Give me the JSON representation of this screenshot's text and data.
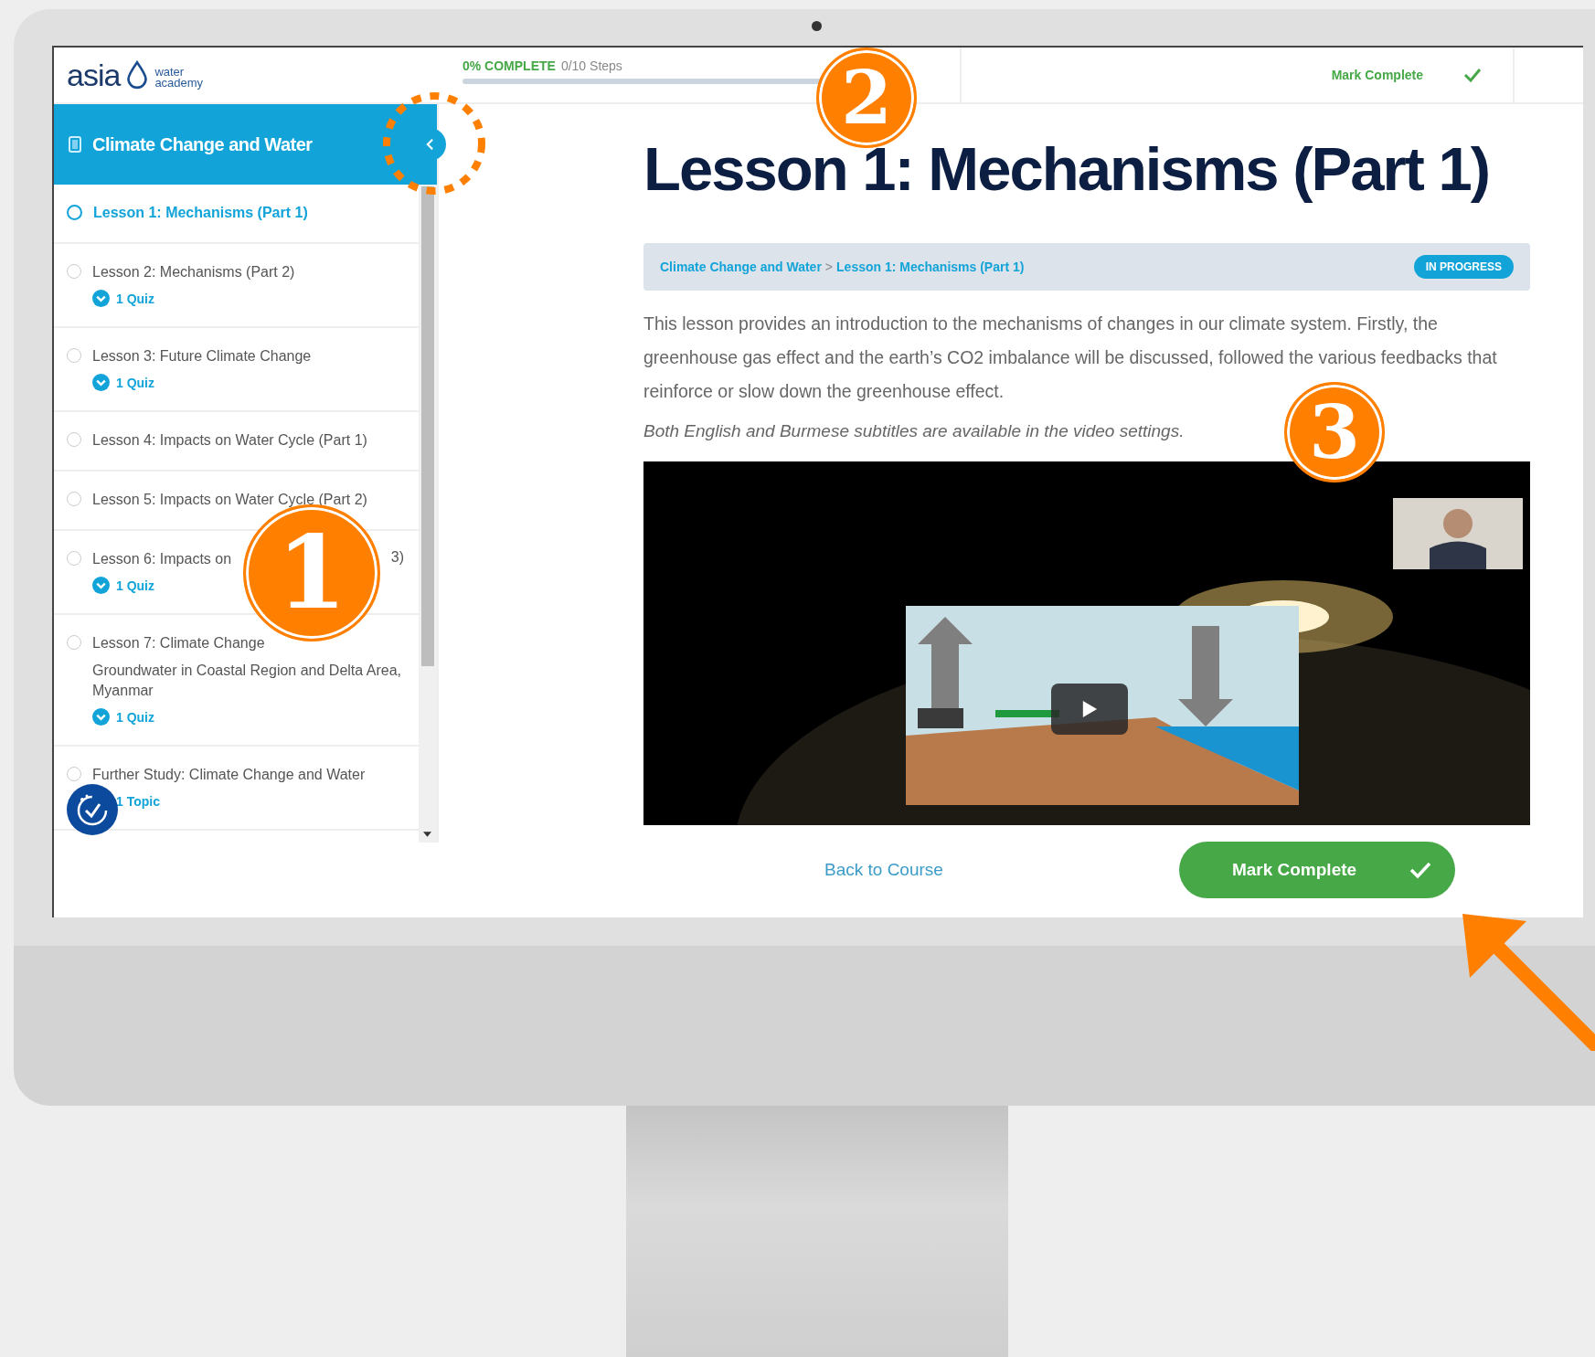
{
  "logo": {
    "name": "asia",
    "sub": [
      "water",
      "academy"
    ]
  },
  "progress": {
    "percent": "0% COMPLETE",
    "steps": "0/10 Steps",
    "level": 0
  },
  "header_action": {
    "label": "Mark Complete"
  },
  "sidebar": {
    "title": "Climate Change and Water",
    "lessons": [
      {
        "kind": "lesson",
        "title": "Lesson 1: Mechanisms (Part 1)",
        "selected": true
      },
      {
        "kind": "quiz",
        "title": "Lesson 2: Mechanisms (Part 2)",
        "selected": false,
        "sub": "1 Quiz"
      },
      {
        "kind": "quiz",
        "title": "Lesson 3: Future Climate Change",
        "selected": false,
        "sub": "1 Quiz"
      },
      {
        "kind": "lesson",
        "title": "Lesson 4: Impacts on Water Cycle (Part 1)",
        "selected": false
      },
      {
        "kind": "lesson",
        "title": "Lesson 5: Impacts on Water Cycle (Part 2)",
        "selected": false
      },
      {
        "kind": "quiz",
        "title": "Lesson 6: Impacts on",
        "title_end": "3)",
        "selected": false,
        "sub": "1 Quiz"
      },
      {
        "kind": "quiz",
        "title": "Lesson 7: Climate Change",
        "title_next": "Groundwater in Coastal Region and Delta Area, Myanmar",
        "selected": false,
        "sub": "1 Quiz"
      },
      {
        "kind": "topic",
        "title": "Further Study: Climate Change and Water",
        "selected": false,
        "sub": "1 Topic"
      }
    ]
  },
  "lesson": {
    "title": "Lesson 1: Mechanisms (Part 1)",
    "breadcrumb": [
      "Climate Change and Water",
      "Lesson 1: Mechanisms (Part 1)"
    ],
    "breadcrumb_separator": ">",
    "status": "IN PROGRESS",
    "description": "This lesson provides an introduction to the mechanisms of changes in our climate system. Firstly, the greenhouse gas effect and the earth’s CO2 imbalance will be discussed, followed the various feedbacks that reinforce or slow down the greenhouse effect.",
    "note": "Both English and Burmese subtitles are available in the video settings.",
    "video": {
      "kind": "picture"
    }
  },
  "footer": {
    "back": "Back to Course",
    "complete": "Mark Complete"
  },
  "callouts": [
    {
      "label": "1"
    },
    {
      "label": "2"
    },
    {
      "label": "3"
    }
  ]
}
